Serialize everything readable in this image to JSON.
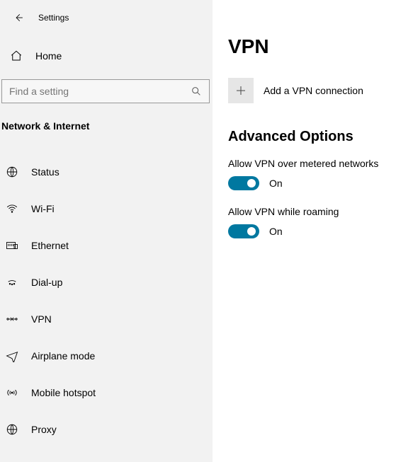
{
  "titlebar": {
    "title": "Settings"
  },
  "home": {
    "label": "Home"
  },
  "search": {
    "placeholder": "Find a setting"
  },
  "section": {
    "label": "Network & Internet"
  },
  "nav": {
    "status": {
      "label": "Status"
    },
    "wifi": {
      "label": "Wi-Fi"
    },
    "ethernet": {
      "label": "Ethernet"
    },
    "dialup": {
      "label": "Dial-up"
    },
    "vpn": {
      "label": "VPN"
    },
    "airplane": {
      "label": "Airplane mode"
    },
    "hotspot": {
      "label": "Mobile hotspot"
    },
    "proxy": {
      "label": "Proxy"
    }
  },
  "page": {
    "title": "VPN",
    "add_label": "Add a VPN connection",
    "advanced_header": "Advanced Options",
    "toggle1_label": "Allow VPN over metered networks",
    "toggle1_state": "On",
    "toggle2_label": "Allow VPN while roaming",
    "toggle2_state": "On"
  }
}
